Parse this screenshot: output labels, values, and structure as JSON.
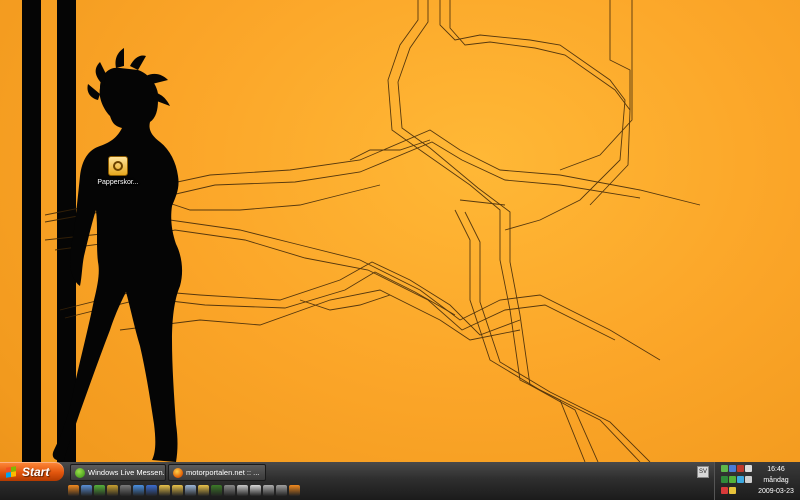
{
  "desktop": {
    "icons": [
      {
        "label": "Papperskor..."
      }
    ],
    "colors": {
      "background": "#fba528",
      "silhouette": "#050505",
      "lines": "#3a2408"
    }
  },
  "taskbar": {
    "start_label": "Start",
    "tasks": [
      {
        "label": "Windows Live Messen...",
        "icon": "messenger-icon"
      },
      {
        "label": "motorportalen.net :: ...",
        "icon": "firefox-icon"
      }
    ],
    "language_indicator": "SV",
    "quick_launch": [
      {
        "icon": "firefox-icon",
        "color": "#f28a1e"
      },
      {
        "icon": "explorer-icon",
        "color": "#5a8fd6"
      },
      {
        "icon": "messenger-icon",
        "color": "#55b23a"
      },
      {
        "icon": "shield-icon",
        "color": "#c8a030"
      },
      {
        "icon": "media-icon",
        "color": "#7a7a7a"
      },
      {
        "icon": "globe-icon",
        "color": "#4a90e2"
      },
      {
        "icon": "terminal-icon",
        "color": "#3b6ccf"
      },
      {
        "icon": "folder-icon",
        "color": "#e9c24a"
      },
      {
        "icon": "folder-icon",
        "color": "#e9c24a"
      },
      {
        "icon": "drive-icon",
        "color": "#9db7d8"
      },
      {
        "icon": "folder-icon",
        "color": "#e9c24a"
      },
      {
        "icon": "skull-icon",
        "color": "#3c7a28"
      },
      {
        "icon": "game-icon",
        "color": "#8a8a8a"
      },
      {
        "icon": "monitor-icon",
        "color": "#c8c8c8"
      },
      {
        "icon": "app-icon",
        "color": "#d8d8d8"
      },
      {
        "icon": "app-icon",
        "color": "#b0b0b0"
      },
      {
        "icon": "app-icon",
        "color": "#a0a0a0"
      },
      {
        "icon": "firefox-icon",
        "color": "#f28a1e"
      }
    ]
  },
  "tray": {
    "icons": [
      {
        "icon": "network-icon",
        "color": "#5fb84a"
      },
      {
        "icon": "monitor-icon",
        "color": "#4a7bd6"
      },
      {
        "icon": "antivirus-icon",
        "color": "#c0392b"
      },
      {
        "icon": "volume-icon",
        "color": "#dcdcdc"
      },
      {
        "icon": "shield-icon",
        "color": "#2f8a3a"
      },
      {
        "icon": "messenger-icon",
        "color": "#55b23a"
      },
      {
        "icon": "sync-icon",
        "color": "#3da9e0"
      },
      {
        "icon": "wireless-icon",
        "color": "#cfcfcf"
      },
      {
        "icon": "alert-icon",
        "color": "#d83a3a"
      },
      {
        "icon": "arrow-icon",
        "color": "#e6c23a"
      }
    ],
    "clock": {
      "time": "16:46",
      "day": "måndag",
      "date": "2009-03-23"
    }
  }
}
